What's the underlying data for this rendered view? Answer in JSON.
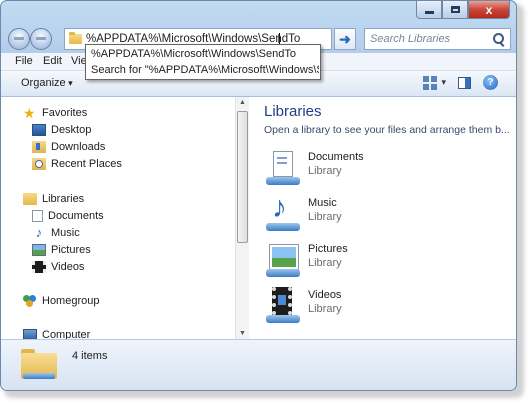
{
  "address": {
    "path": "%APPDATA%\\Microsoft\\Windows\\SendTo",
    "suggestions": [
      "%APPDATA%\\Microsoft\\Windows\\SendTo",
      "Search for \"%APPDATA%\\Microsoft\\Windows\\SendTo\""
    ]
  },
  "search": {
    "placeholder": "Search Libraries"
  },
  "window_controls": {
    "close": "x"
  },
  "menu": [
    "File",
    "Edit",
    "Vie"
  ],
  "toolbar": {
    "organize": "Organize",
    "help": "?"
  },
  "nav": {
    "favorites": {
      "label": "Favorites",
      "items": [
        "Desktop",
        "Downloads",
        "Recent Places"
      ]
    },
    "libraries": {
      "label": "Libraries",
      "items": [
        "Documents",
        "Music",
        "Pictures",
        "Videos"
      ]
    },
    "homegroup": "Homegroup",
    "computer": "Computer"
  },
  "content": {
    "title": "Libraries",
    "subtitle": "Open a library to see your files and arrange them b...",
    "items": [
      {
        "name": "Documents",
        "type": "Library"
      },
      {
        "name": "Music",
        "type": "Library"
      },
      {
        "name": "Pictures",
        "type": "Library"
      },
      {
        "name": "Videos",
        "type": "Library"
      }
    ]
  },
  "status": {
    "count": "4 items"
  },
  "colors": {
    "accent": "#1e3e85",
    "chrome": "#b9d1ea",
    "close": "#c9463a"
  }
}
